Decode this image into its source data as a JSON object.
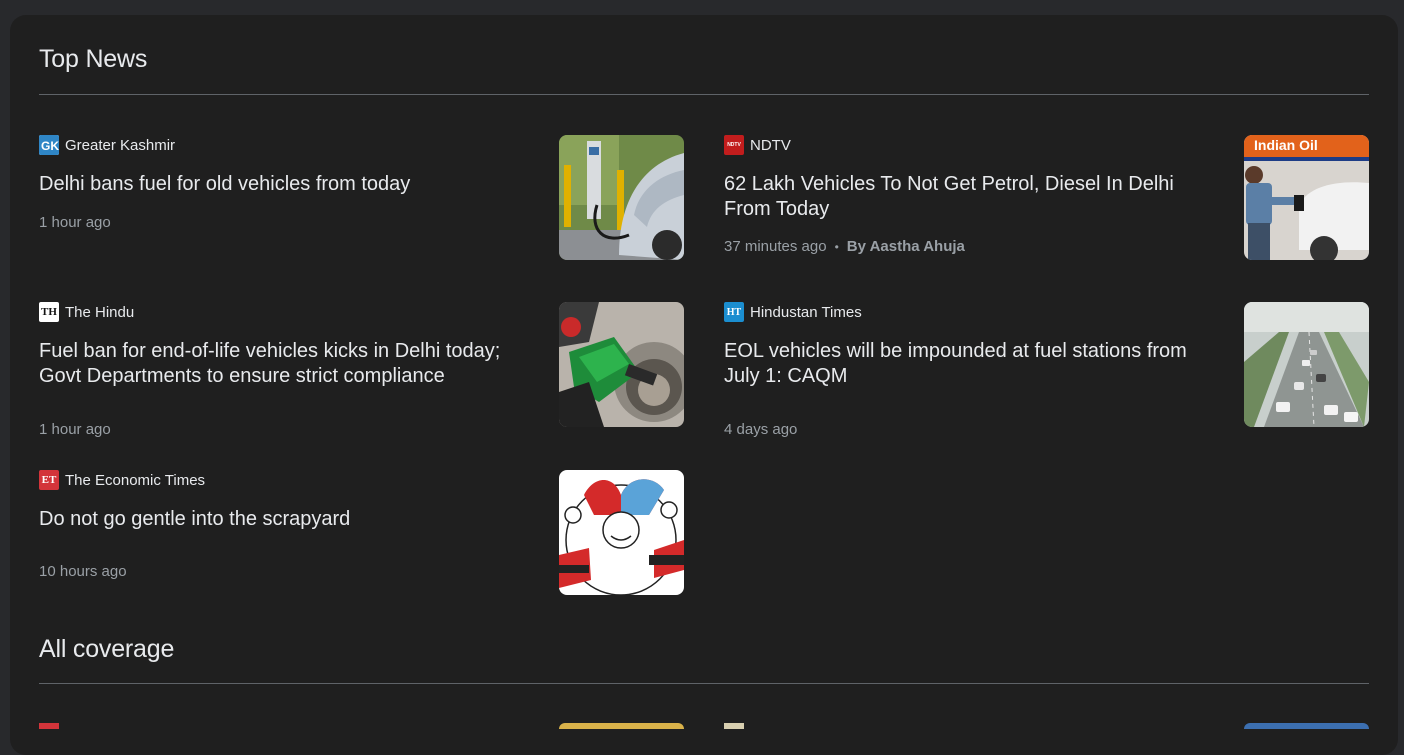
{
  "top_news": {
    "title": "Top News",
    "articles": [
      {
        "source": "Greater Kashmir",
        "logo_text": "GK",
        "headline": "Delhi bans fuel for old vehicles from today",
        "time": "1 hour ago",
        "image": "ev-charging-car"
      },
      {
        "source": "NDTV",
        "logo_text": "NDTV",
        "headline": "62 Lakh Vehicles To Not Get Petrol, Diesel In Delhi From Today",
        "time": "37 minutes ago",
        "author": "By Aastha Ahuja",
        "image": "petrol-pump-attendant",
        "image_text": "Indian Oil"
      },
      {
        "source": "The Hindu",
        "logo_text": "TH",
        "headline": "Fuel ban for end-of-life vehicles kicks in Delhi today; Govt Departments to ensure strict compliance",
        "time": "1 hour ago",
        "image": "fuel-nozzle"
      },
      {
        "source": "Hindustan Times",
        "logo_text": "HT",
        "headline": "EOL vehicles will be impounded at fuel stations from July 1: CAQM",
        "time": "4 days ago",
        "image": "highway-traffic"
      },
      {
        "source": "The Economic Times",
        "logo_text": "ET",
        "headline": "Do not go gentle into the scrapyard",
        "time": "10 hours ago",
        "image": "jester-cartoon"
      }
    ]
  },
  "all_coverage": {
    "title": "All coverage"
  },
  "colors": {
    "background": "#28292c",
    "panel": "#1f1f1f",
    "text": "#e8eaed",
    "muted": "#9aa0a6",
    "ndtv_red": "#c21d1d",
    "et_red": "#d3343a",
    "gk_blue": "#2f86c6",
    "ht_blue": "#1b8ed0"
  }
}
